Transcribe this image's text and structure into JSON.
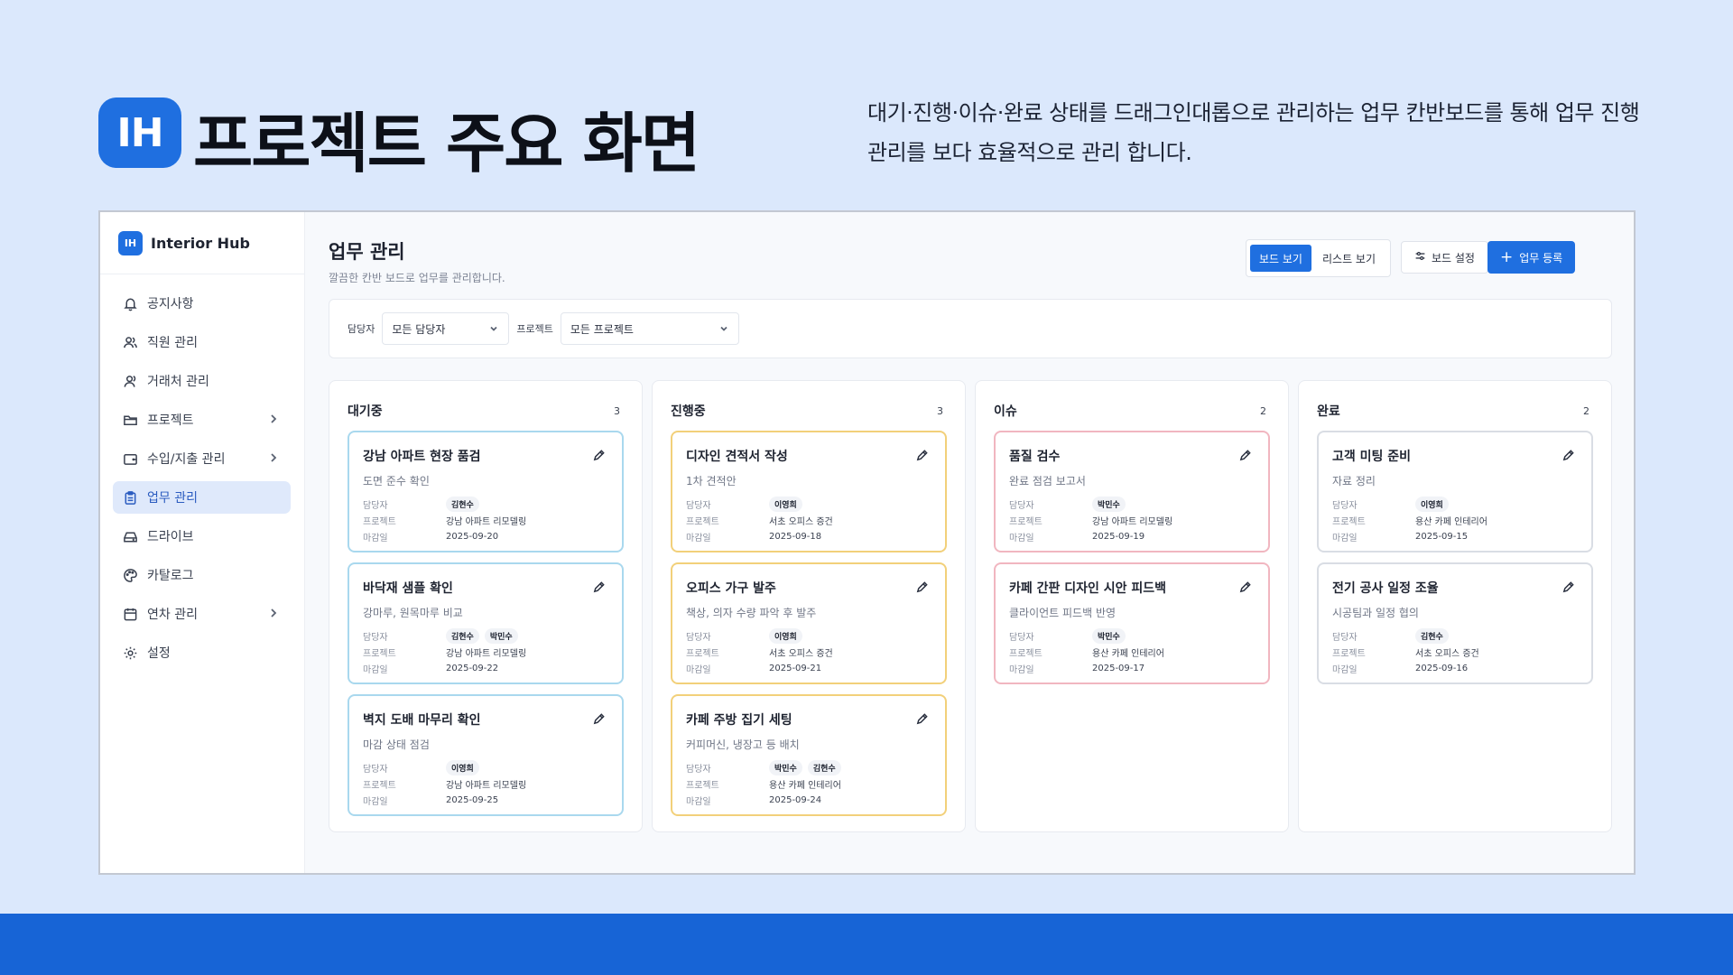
{
  "hero": {
    "logo": "IH",
    "title": "프로젝트 주요 화면",
    "description": "대기·진행·이슈·완료 상태를 드래그인대롭으로 관리하는 업무 칸반보드를 통해 업무 진행 관리를 보다 효율적으로 관리 합니다."
  },
  "colors": {
    "accent": "#1f6fe0",
    "background": "#dbe8fc",
    "band": "#1764d6"
  },
  "brand": {
    "logo": "IH",
    "name": "Interior Hub"
  },
  "sidebar": {
    "items": [
      {
        "label": "공지사항",
        "icon": "bell-icon",
        "chevron": false,
        "active": false
      },
      {
        "label": "직원 관리",
        "icon": "users-icon",
        "chevron": false,
        "active": false
      },
      {
        "label": "거래처 관리",
        "icon": "user-icon",
        "chevron": false,
        "active": false
      },
      {
        "label": "프로젝트",
        "icon": "folder-icon",
        "chevron": true,
        "active": false
      },
      {
        "label": "수입/지출 관리",
        "icon": "wallet-icon",
        "chevron": true,
        "active": false
      },
      {
        "label": "업무 관리",
        "icon": "clipboard-icon",
        "chevron": false,
        "active": true
      },
      {
        "label": "드라이브",
        "icon": "drive-icon",
        "chevron": false,
        "active": false
      },
      {
        "label": "카탈로그",
        "icon": "palette-icon",
        "chevron": false,
        "active": false
      },
      {
        "label": "연차 관리",
        "icon": "calendar-icon",
        "chevron": true,
        "active": false
      },
      {
        "label": "설정",
        "icon": "gear-icon",
        "chevron": false,
        "active": false
      }
    ]
  },
  "page": {
    "title": "업무 관리",
    "subtitle": "깔끔한 칸반 보드로 업무를 관리합니다."
  },
  "toolbar": {
    "board_view": "보드 보기",
    "list_view": "리스트 보기",
    "settings": "보드 설정",
    "add": "업무 등록",
    "selected_view": "board"
  },
  "filters": {
    "assignee_label": "담당자",
    "assignee_value": "모든 담당자",
    "project_label": "프로젝트",
    "project_value": "모든 프로젝트"
  },
  "card_labels": {
    "assignee": "담당자",
    "project": "프로젝트",
    "due": "마감일"
  },
  "columns": [
    {
      "title": "대기중",
      "count": "3",
      "kind": "wait",
      "cards": [
        {
          "title": "강남 아파트 현장 품검",
          "desc": "도면 준수 확인",
          "assignees": [
            "김현수"
          ],
          "project": "강남 아파트 리모델링",
          "due": "2025-09-20"
        },
        {
          "title": "바닥재 샘플 확인",
          "desc": "강마루, 원목마루 비교",
          "assignees": [
            "김현수",
            "박민수"
          ],
          "project": "강남 아파트 리모델링",
          "due": "2025-09-22"
        },
        {
          "title": "벽지 도배 마무리 확인",
          "desc": "마감 상태 점검",
          "assignees": [
            "이영희"
          ],
          "project": "강남 아파트 리모델링",
          "due": "2025-09-25"
        }
      ]
    },
    {
      "title": "진행중",
      "count": "3",
      "kind": "prog",
      "cards": [
        {
          "title": "디자인 견적서 작성",
          "desc": "1차 견적안",
          "assignees": [
            "이영희"
          ],
          "project": "서초 오피스 증건",
          "due": "2025-09-18"
        },
        {
          "title": "오피스 가구 발주",
          "desc": "책상, 의자 수량 파악 후 발주",
          "assignees": [
            "이영희"
          ],
          "project": "서초 오피스 증건",
          "due": "2025-09-21"
        },
        {
          "title": "카페 주방 집기 세팅",
          "desc": "커피머신, 냉장고 등 배치",
          "assignees": [
            "박민수",
            "김현수"
          ],
          "project": "용산 카페 인테리어",
          "due": "2025-09-24"
        }
      ]
    },
    {
      "title": "이슈",
      "count": "2",
      "kind": "issue",
      "cards": [
        {
          "title": "품질 검수",
          "desc": "완료 점검 보고서",
          "assignees": [
            "박민수"
          ],
          "project": "강남 아파트 리모델링",
          "due": "2025-09-19"
        },
        {
          "title": "카페 간판 디자인 시안 피드백",
          "desc": "클라이언트 피드백 반영",
          "assignees": [
            "박민수"
          ],
          "project": "용산 카페 인테리어",
          "due": "2025-09-17"
        }
      ]
    },
    {
      "title": "완료",
      "count": "2",
      "kind": "done",
      "cards": [
        {
          "title": "고객 미팅 준비",
          "desc": "자료 정리",
          "assignees": [
            "이영희"
          ],
          "project": "용산 카페 인테리어",
          "due": "2025-09-15"
        },
        {
          "title": "전기 공사 일정 조율",
          "desc": "시공팀과 일정 협의",
          "assignees": [
            "김현수"
          ],
          "project": "서초 오피스 증건",
          "due": "2025-09-16"
        }
      ]
    }
  ]
}
